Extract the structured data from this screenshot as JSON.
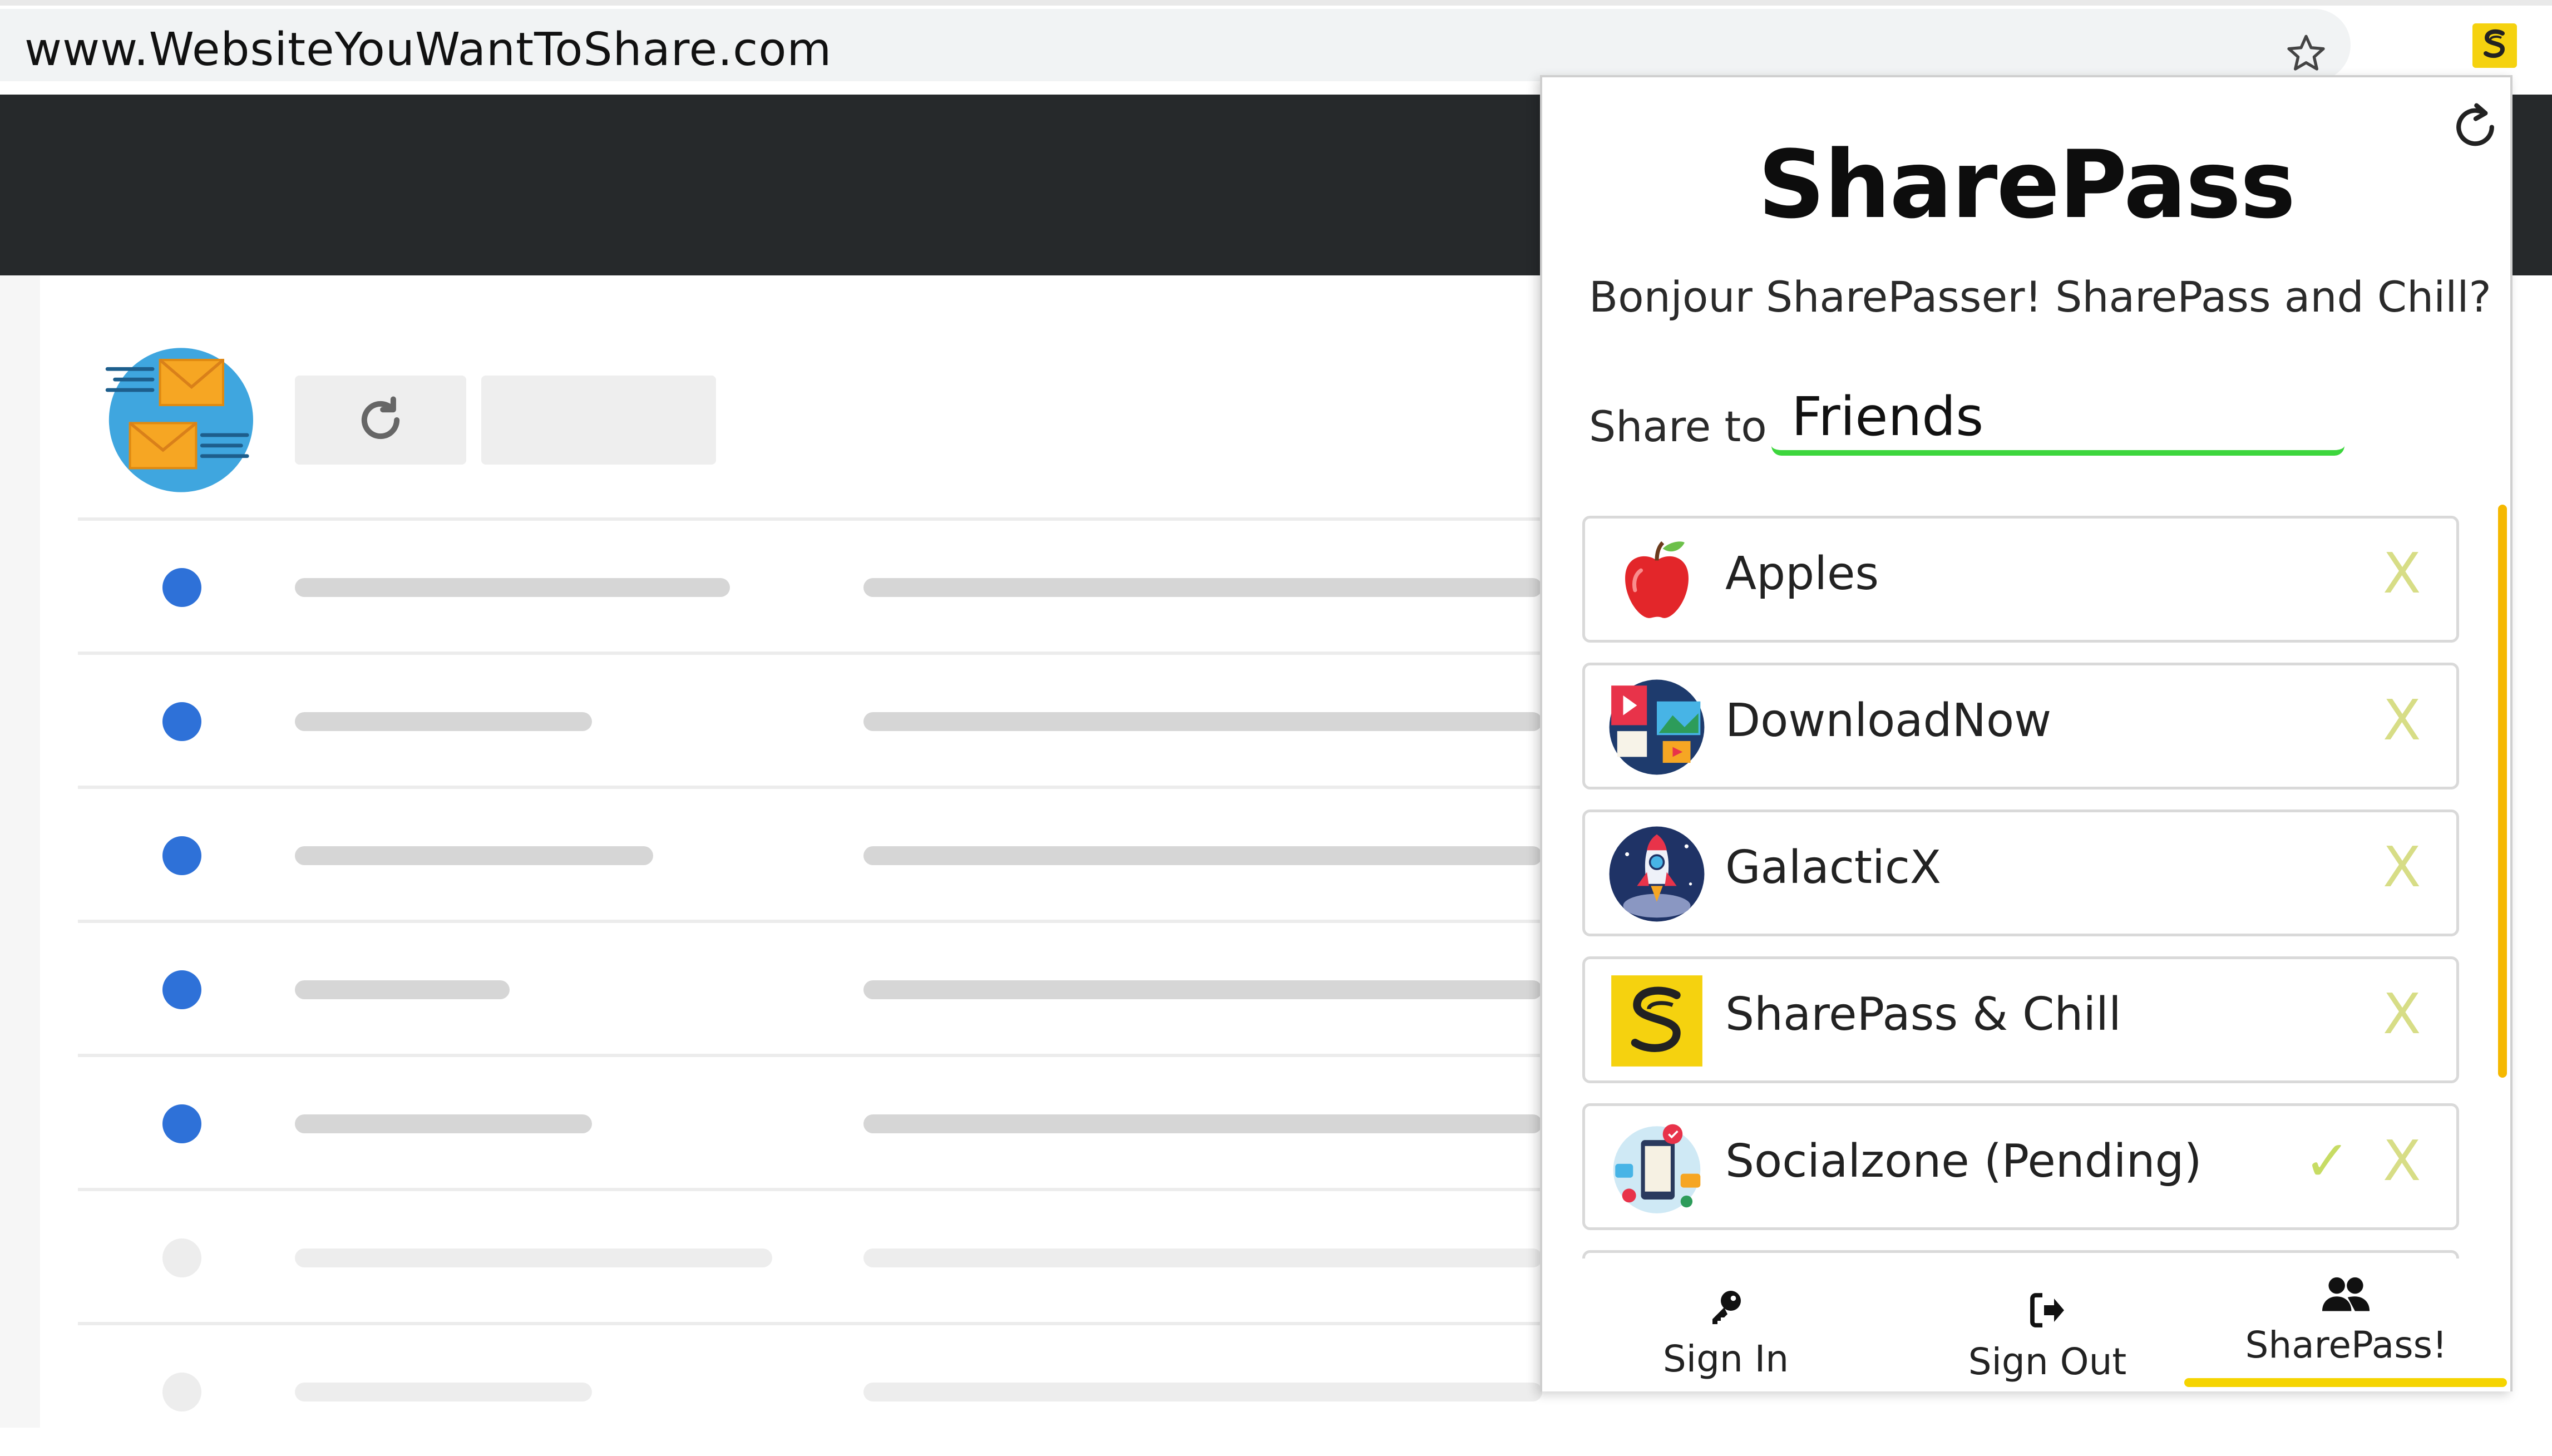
{
  "browser": {
    "url": "www.WebsiteYouWantToShare.com",
    "bookmark_icon": "star-icon",
    "extension_icon": "sharepass-extension-icon"
  },
  "background_page": {
    "rows": [
      {
        "unread": true
      },
      {
        "unread": true
      },
      {
        "unread": true
      },
      {
        "unread": true
      },
      {
        "unread": true
      },
      {
        "unread": false
      },
      {
        "unread": false
      }
    ]
  },
  "popup": {
    "brand": "SharePass",
    "greeting": "Bonjour SharePasser! SharePass and Chill?",
    "share_label": "Share to",
    "share_value": "Friends",
    "accent_color": "#3dd63d",
    "highlight_color": "#f5d400",
    "services": [
      {
        "name": "Apples",
        "icon": "apple-icon",
        "pending": false
      },
      {
        "name": "DownloadNow",
        "icon": "media-icon",
        "pending": false
      },
      {
        "name": "GalacticX",
        "icon": "rocket-icon",
        "pending": false
      },
      {
        "name": "SharePass & Chill",
        "icon": "sharepass-logo-icon",
        "pending": false
      },
      {
        "name": "Socialzone (Pending)",
        "icon": "social-icon",
        "pending": true
      }
    ],
    "remove_label": "X",
    "accept_label": "✓",
    "tabs": [
      {
        "label": "Sign In",
        "icon": "key-icon"
      },
      {
        "label": "Sign Out",
        "icon": "sign-out-icon"
      },
      {
        "label": "SharePass!",
        "icon": "users-icon",
        "active": true
      }
    ]
  }
}
